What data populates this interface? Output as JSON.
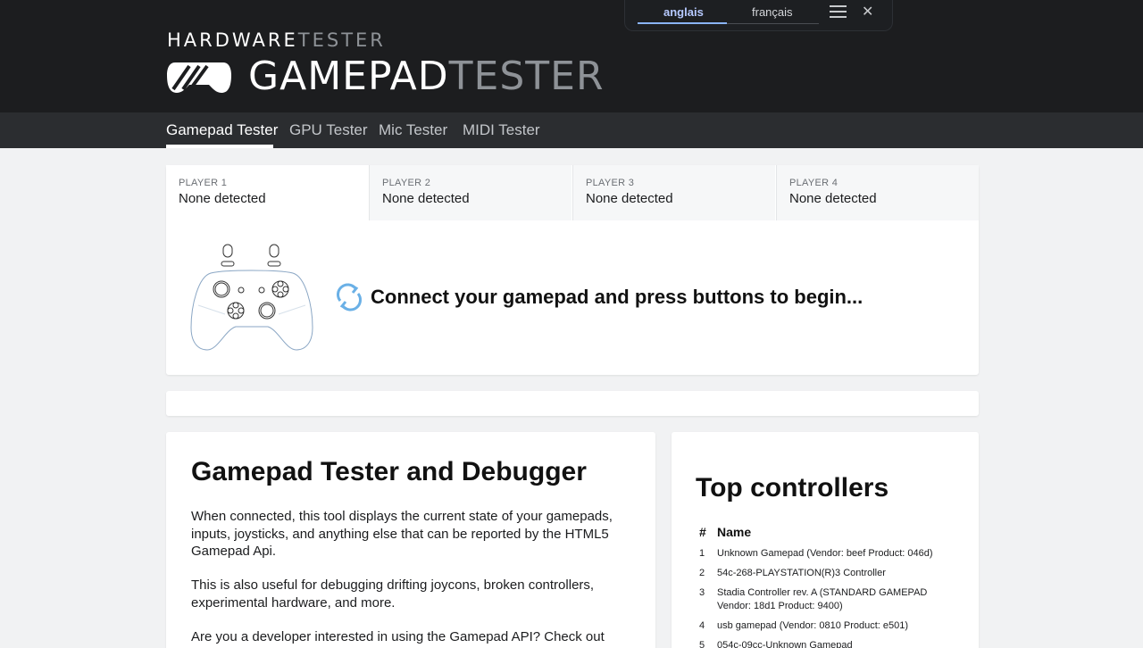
{
  "header": {
    "brand_part1": "HARDWARE",
    "brand_part2": "TESTER",
    "title_part1": "GAMEPAD",
    "title_part2": "TESTER"
  },
  "translate": {
    "lang_source": "anglais",
    "lang_target": "français",
    "menu_icon": "hamburger-menu-icon",
    "close_icon": "close-icon"
  },
  "nav": {
    "items": [
      {
        "label": "Gamepad Tester",
        "active": true
      },
      {
        "label": "GPU Tester"
      },
      {
        "label": "Mic Tester"
      },
      {
        "label": "MIDI Tester"
      }
    ]
  },
  "players": [
    {
      "label": "PLAYER 1",
      "status": "None detected"
    },
    {
      "label": "PLAYER 2",
      "status": "None detected"
    },
    {
      "label": "PLAYER 3",
      "status": "None detected"
    },
    {
      "label": "PLAYER 4",
      "status": "None detected"
    }
  ],
  "connect_message": "Connect your gamepad and press buttons to begin...",
  "info": {
    "title": "Gamepad Tester and Debugger",
    "paragraphs": [
      "When connected, this tool displays the current state of your gamepads, inputs, joysticks, and anything else that can be reported by the HTML5 Gamepad Api.",
      "This is also useful for debugging drifting joycons, broken controllers, experimental hardware, and more.",
      "Are you a developer interested in using the Gamepad API? Check out this"
    ]
  },
  "top_controllers": {
    "title": "Top controllers",
    "col_num": "#",
    "col_name": "Name",
    "rows": [
      {
        "num": "1",
        "name": "Unknown Gamepad (Vendor: beef Product: 046d)"
      },
      {
        "num": "2",
        "name": "54c-268-PLAYSTATION(R)3 Controller"
      },
      {
        "num": "3",
        "name": "Stadia Controller rev. A (STANDARD GAMEPAD Vendor: 18d1 Product: 9400)"
      },
      {
        "num": "4",
        "name": "usb gamepad (Vendor: 0810 Product: e501)"
      },
      {
        "num": "5",
        "name": "054c-09cc-Unknown Gamepad"
      }
    ]
  },
  "colors": {
    "header_bg": "#1c1d1f",
    "nav_bg": "#2b2d30",
    "accent_blue": "#8ab4f8",
    "refresh_icon": "#6ab0e6"
  }
}
